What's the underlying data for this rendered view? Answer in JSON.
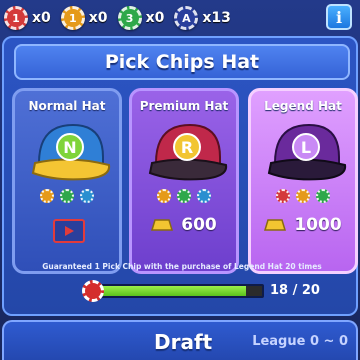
{
  "currencies": [
    {
      "label": "1",
      "count": "x0",
      "color": "#d43a3a",
      "icon": "chip-1-icon"
    },
    {
      "label": "1",
      "count": "x0",
      "color": "#e59a1a",
      "icon": "chip-1-gold-icon"
    },
    {
      "label": "3",
      "count": "x0",
      "color": "#2ea84a",
      "icon": "chip-3-icon"
    },
    {
      "label": "A",
      "count": "x13",
      "color": "#2a3f9c",
      "icon": "chip-a-icon"
    }
  ],
  "info_label": "i",
  "title": "Pick Chips Hat",
  "cards": [
    {
      "title": "Normal Hat",
      "hat_letter": "N",
      "price": "",
      "mini_chips": [
        "#e59a1a",
        "#2ea84a",
        "#2a8fd0"
      ]
    },
    {
      "title": "Premium Hat",
      "hat_letter": "R",
      "price": "600",
      "mini_chips": [
        "#e59a1a",
        "#2ea84a",
        "#2a8fd0"
      ]
    },
    {
      "title": "Legend Hat",
      "hat_letter": "L",
      "price": "1000",
      "mini_chips": [
        "#d43a3a",
        "#e59a1a",
        "#2ea84a"
      ]
    }
  ],
  "note": "Guaranteed 1 Pick Chip with the purchase of Legend Hat 20 times",
  "progress": {
    "current": 18,
    "total": 20,
    "text": "18 / 20",
    "fraction": 0.9
  },
  "bottom": {
    "draft": "Draft",
    "league": "League 0 ~ 0"
  },
  "colors": {
    "accent": "#2c55c4",
    "progress": "#7ad832",
    "gold": "#f2c531"
  }
}
